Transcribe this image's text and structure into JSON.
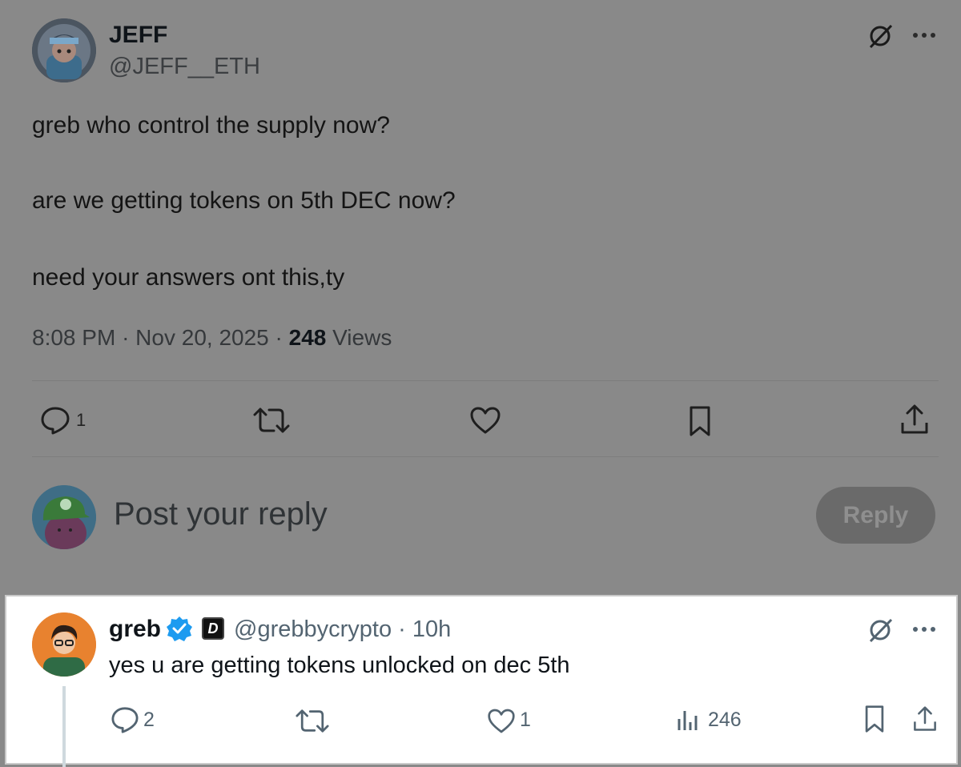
{
  "post": {
    "name": "JEFF",
    "handle": "@JEFF__ETH",
    "lines": [
      "greb who control the supply now?",
      "are we getting tokens on 5th DEC now?",
      "need your answers ont this,ty"
    ],
    "time": "8:08 PM",
    "date": "Nov 20, 2025",
    "views_count": "248",
    "views_label": "Views",
    "replies": "1",
    "icons": [
      "grok-icon",
      "more-icon",
      "reply-icon",
      "repost-icon",
      "like-icon",
      "bookmark-icon",
      "share-icon"
    ]
  },
  "composer": {
    "placeholder": "Post your reply",
    "button": "Reply"
  },
  "reply": {
    "name": "greb",
    "handle": "@grebbycrypto",
    "age": "10h",
    "text": "yes u are getting tokens unlocked on dec 5th",
    "replies": "2",
    "likes": "1",
    "views": "246",
    "badge_letter": "D",
    "accent": "#1d9bf0"
  },
  "colors": {
    "overlay": "#898989",
    "card": "#ffffff",
    "verified": "#1d9bf0"
  }
}
